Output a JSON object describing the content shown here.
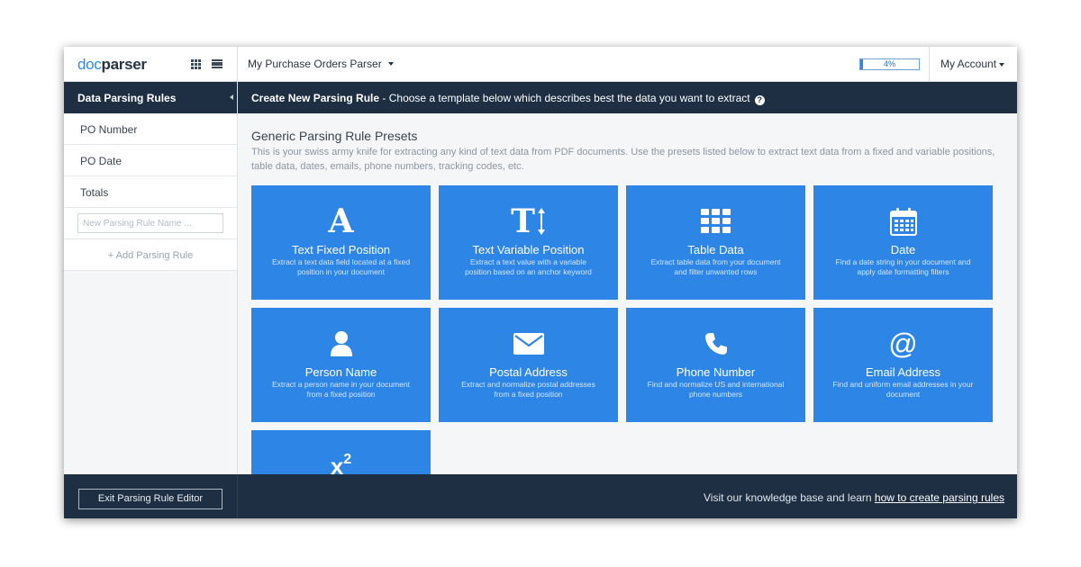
{
  "topbar": {
    "logo": {
      "part1": "doc",
      "part2": "parser"
    },
    "view_icons": [
      "grid-view-icon",
      "list-view-icon"
    ],
    "parser_name": "My Purchase Orders Parser",
    "usage": {
      "percent": 4,
      "label": "4%"
    },
    "account_label": "My Account"
  },
  "sidebar": {
    "header": "Data Parsing Rules",
    "items": [
      {
        "label": "PO Number"
      },
      {
        "label": "PO Date"
      },
      {
        "label": "Totals"
      }
    ],
    "new_rule_placeholder": "New Parsing Rule Name ...",
    "add_rule_label": "+ Add Parsing Rule",
    "exit_button": "Exit Parsing Rule Editor"
  },
  "main": {
    "header_title": "Create New Parsing Rule",
    "header_subtitle": " - Choose a template below which describes best the data you want to extract",
    "section_title": "Generic Parsing Rule Presets",
    "section_desc": "This is your swiss army knife for extracting any kind of text data from PDF documents. Use the presets listed below to extract text data from a fixed and variable positions, table data, dates, emails, phone numbers, tracking codes, etc.",
    "cards": [
      {
        "title": "Text Fixed Position",
        "desc": "Extract a text data field located at a fixed position in your document",
        "icon": "letter-a-icon",
        "glyph": "A"
      },
      {
        "title": "Text Variable Position",
        "desc": "Extract a text value with a variable position based on an anchor keyword",
        "icon": "text-height-icon",
        "glyph": "T"
      },
      {
        "title": "Table Data",
        "desc": "Extract table data from your document and filter unwanted rows",
        "icon": "table-grid-icon"
      },
      {
        "title": "Date",
        "desc": "Find a date string in your document and apply date formatting filters",
        "icon": "calendar-icon"
      },
      {
        "title": "Person Name",
        "desc": "Extract a person name in your document from a fixed position",
        "icon": "user-icon"
      },
      {
        "title": "Postal Address",
        "desc": "Extract and normalize postal addresses from a fixed position",
        "icon": "envelope-icon"
      },
      {
        "title": "Phone Number",
        "desc": "Find and normalize US and international phone numbers",
        "icon": "phone-icon"
      },
      {
        "title": "Email Address",
        "desc": "Find and uniform email addresses in your document",
        "icon": "at-sign-icon",
        "glyph": "@"
      },
      {
        "title": "",
        "desc": "",
        "icon": "superscript-icon",
        "glyph": "x",
        "glyph_sup": "2"
      }
    ]
  },
  "footer": {
    "text": "Visit our knowledge base and learn ",
    "link": "how to create parsing rules"
  },
  "colors": {
    "navy": "#1e2f44",
    "card_blue": "#2d86e5",
    "accent": "#2d8ae6"
  }
}
